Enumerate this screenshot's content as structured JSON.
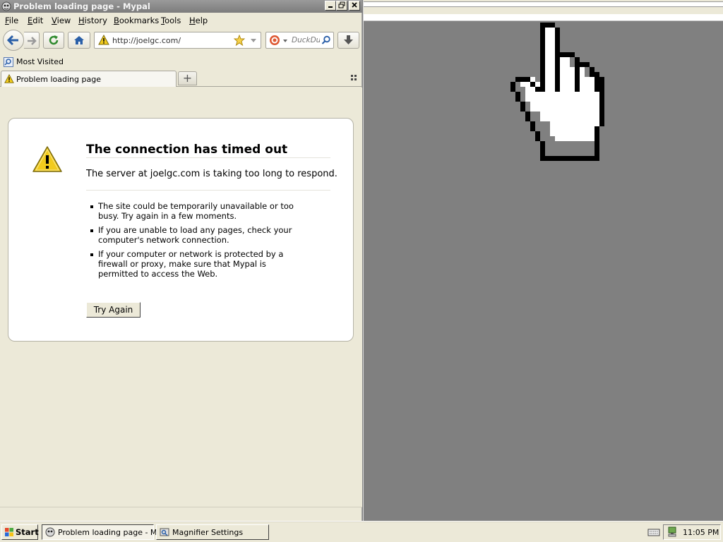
{
  "window": {
    "title": "Problem loading page - Mypal"
  },
  "menu": [
    {
      "accel": "F",
      "rest": "ile"
    },
    {
      "accel": "E",
      "rest": "dit"
    },
    {
      "accel": "V",
      "rest": "iew"
    },
    {
      "accel": "H",
      "rest": "istory"
    },
    {
      "accel": "B",
      "rest": "ookmarks"
    },
    {
      "accel": "T",
      "rest": "ools"
    },
    {
      "accel": "H",
      "rest": "elp"
    }
  ],
  "navbar": {
    "url": "http://joelgc.com/",
    "search_placeholder": "DuckDu"
  },
  "bookmarks": {
    "most_visited": "Most Visited"
  },
  "tabs": {
    "active_label": "Problem loading page",
    "new_tab_symbol": "+"
  },
  "error": {
    "title": "The connection has timed out",
    "description": "The server at joelgc.com is taking too long to respond.",
    "bullets": [
      "The site could be temporarily unavailable or too busy. Try again in a few moments.",
      "If you are unable to load any pages, check your computer's network connection.",
      "If your computer or network is protected by a firewall or proxy, make sure that Mypal is permitted to access the Web."
    ],
    "button": "Try Again"
  },
  "taskbar": {
    "start": "Start",
    "tasks": [
      "Problem loading page - M...",
      "Magnifier Settings"
    ],
    "clock": "11:05 PM"
  },
  "colors": {
    "window_bg": "#ECE9D8",
    "magnifier_bg": "#808080",
    "titlebar_inactive": "#8a8a8a",
    "warning_yellow": "#F2CB1D"
  }
}
